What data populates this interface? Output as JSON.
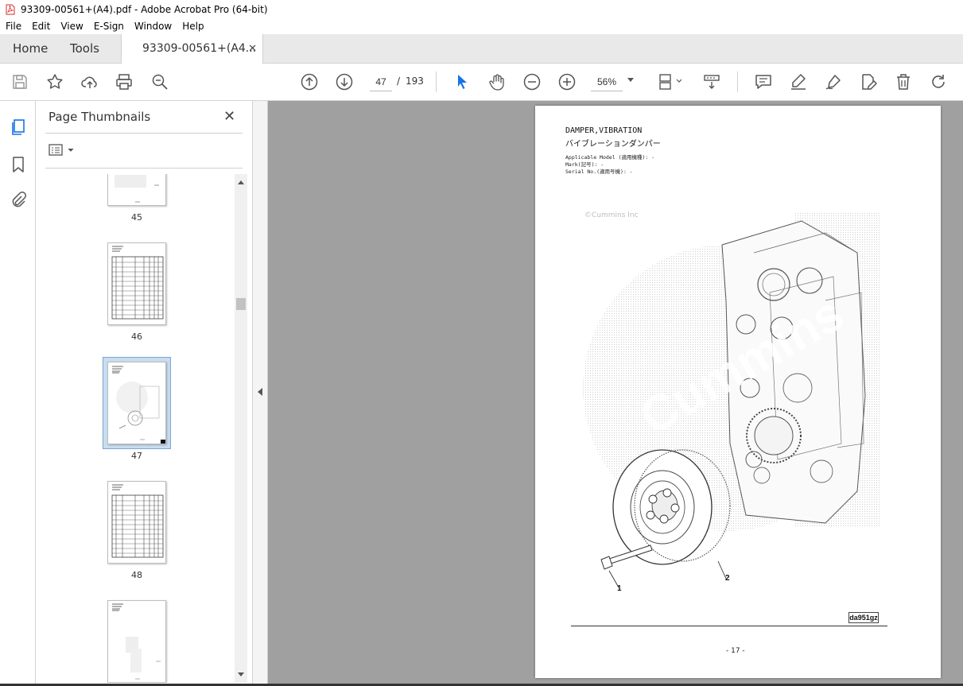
{
  "window": {
    "title": "93309-00561+(A4).pdf - Adobe Acrobat Pro (64-bit)",
    "app_icon": "acrobat-pdf-icon"
  },
  "menu": [
    "File",
    "Edit",
    "View",
    "E-Sign",
    "Window",
    "Help"
  ],
  "tabs": {
    "home": "Home",
    "tools": "Tools",
    "document": "93309-00561+(A4...",
    "close_glyph": "✕"
  },
  "toolbar": {
    "page_current": "47",
    "page_separator": "/",
    "page_total": "193",
    "zoom": "56%",
    "icons": [
      "save-icon",
      "bookmark-star-icon",
      "upload-cloud-icon",
      "print-icon",
      "search-zoom-icon",
      "page-up-icon",
      "page-down-icon",
      "select-arrow-icon",
      "hand-tool-icon",
      "zoom-out-icon",
      "zoom-in-icon",
      "page-display-icon",
      "scroll-mode-icon",
      "comment-icon",
      "highlight-pen-icon",
      "sign-icon",
      "edit-pdf-icon",
      "delete-icon",
      "rotate-icon"
    ]
  },
  "sidebar": {
    "title": "Page Thumbnails",
    "close_glyph": "✕",
    "options_icon": "thumbnail-options-icon",
    "rail_icons": [
      "page-thumbnails-icon",
      "bookmarks-icon",
      "attachments-icon"
    ],
    "thumbnails": [
      {
        "label": "45",
        "kind": "image-sparse",
        "selected": false
      },
      {
        "label": "46",
        "kind": "table",
        "selected": false
      },
      {
        "label": "47",
        "kind": "drawing",
        "selected": true
      },
      {
        "label": "48",
        "kind": "table",
        "selected": false
      },
      {
        "label": "",
        "kind": "image-sparse",
        "selected": false
      }
    ]
  },
  "page": {
    "title_en": "DAMPER,VIBRATION",
    "title_jp": "バイブレーションダンパー",
    "meta": [
      "Applicable Model (適用機種): -",
      "Mark(記号): -",
      "Serial No.(適用号機): -"
    ],
    "watermark_copyright": "©Cummins Inc",
    "watermark_brand": "Cummins",
    "callouts": [
      "1",
      "2"
    ],
    "figure_code": "da951gz",
    "page_number": "- 17 -"
  },
  "colors": {
    "tab_bar": "#e9e9e9",
    "doc_background": "#a0a0a0",
    "selected_thumb": "#c9ddf0",
    "accent_blue": "#1473e6"
  }
}
